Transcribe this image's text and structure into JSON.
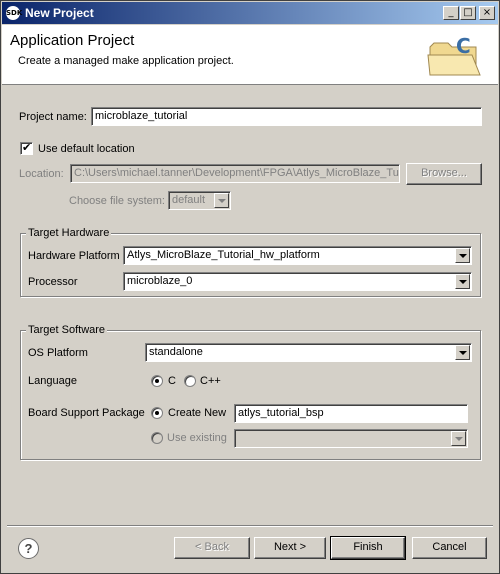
{
  "window": {
    "title": "New Project",
    "app_icon_text": "SDK",
    "minimize_glyph": "_",
    "maximize_glyph": "□",
    "close_glyph": "×"
  },
  "banner": {
    "heading": "Application Project",
    "description": "Create a managed make application project.",
    "art_letter": "C"
  },
  "project": {
    "name_label": "Project name:",
    "name_value": "microblaze_tutorial",
    "use_default_location_label": "Use default location",
    "use_default_location_checked": true,
    "location_label": "Location:",
    "location_value": "C:\\Users\\michael.tanner\\Development\\FPGA\\Atlys_MicroBlaze_Tutc",
    "browse_label": "Browse...",
    "file_system_label": "Choose file system:",
    "file_system_value": "default"
  },
  "target_hardware": {
    "group_title": "Target Hardware",
    "platform_label": "Hardware Platform",
    "platform_value": "Atlys_MicroBlaze_Tutorial_hw_platform",
    "processor_label": "Processor",
    "processor_value": "microblaze_0"
  },
  "target_software": {
    "group_title": "Target Software",
    "os_label": "OS Platform",
    "os_value": "standalone",
    "language_label": "Language",
    "language_options": [
      {
        "label": "C",
        "selected": true
      },
      {
        "label": "C++",
        "selected": false
      }
    ],
    "bsp_label": "Board Support Package",
    "create_new_label": "Create New",
    "create_new_selected": true,
    "bsp_name_value": "atlys_tutorial_bsp",
    "use_existing_label": "Use existing",
    "use_existing_value": ""
  },
  "footer": {
    "help_glyph": "?",
    "back_label": "< Back",
    "next_label": "Next >",
    "finish_label": "Finish",
    "cancel_label": "Cancel"
  }
}
